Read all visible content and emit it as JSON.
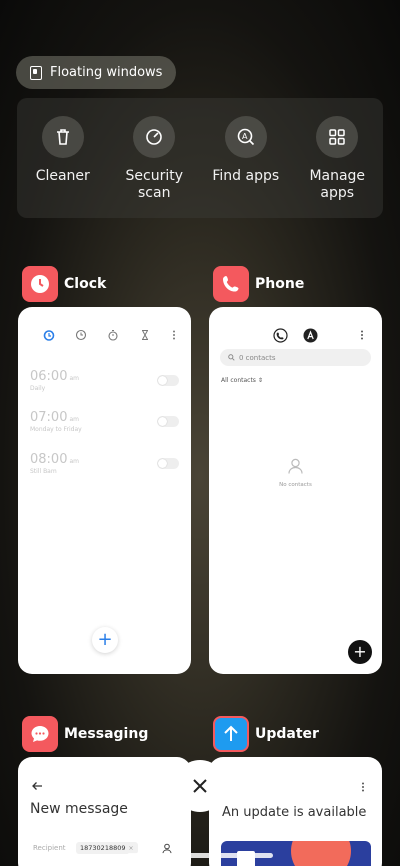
{
  "top": {
    "floating_windows": "Floating windows"
  },
  "tools": [
    {
      "icon": "trash-icon",
      "label": "Cleaner"
    },
    {
      "icon": "gauge-icon",
      "label": "Security\nscan"
    },
    {
      "icon": "search-apps-icon",
      "label": "Find apps"
    },
    {
      "icon": "grid-icon",
      "label": "Manage\napps"
    }
  ],
  "apps": {
    "clock": {
      "name": "Clock",
      "alarms": [
        {
          "time": "06:00",
          "ampm": "am",
          "sub": "Daily"
        },
        {
          "time": "07:00",
          "ampm": "am",
          "sub": "Monday to Friday"
        },
        {
          "time": "08:00",
          "ampm": "am",
          "sub": "Still Bam"
        }
      ]
    },
    "phone": {
      "name": "Phone",
      "search_placeholder": "0 contacts",
      "filter": "All contacts",
      "empty": "No contacts"
    },
    "messaging": {
      "name": "Messaging",
      "title": "New message",
      "recipient_label": "Recipient",
      "recipient_value": "18730218809"
    },
    "updater": {
      "name": "Updater",
      "text": "An update is available"
    }
  },
  "colors": {
    "clock_accent": "#2a7ee8",
    "app_red": "#f4595e",
    "updater_blue": "#1e9bf0"
  }
}
